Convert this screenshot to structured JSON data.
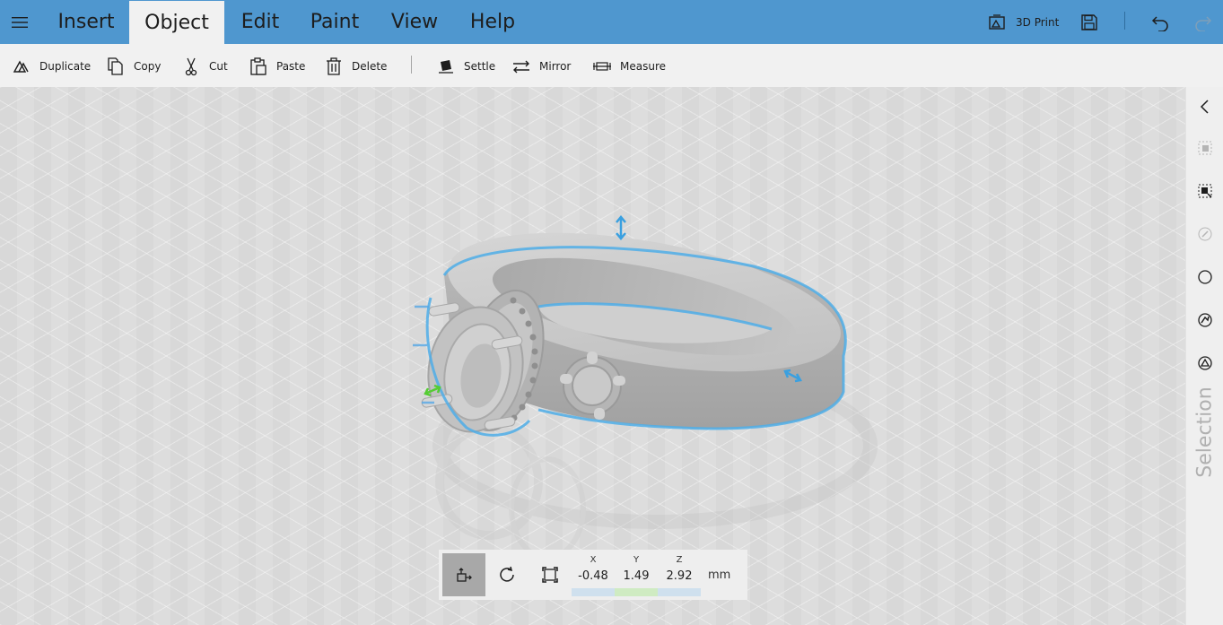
{
  "menubar": {
    "tabs": [
      {
        "label": "Insert"
      },
      {
        "label": "Object"
      },
      {
        "label": "Edit"
      },
      {
        "label": "Paint"
      },
      {
        "label": "View"
      },
      {
        "label": "Help"
      }
    ],
    "active_tab": "Object",
    "print_label": "3D Print",
    "bar_color": "#4f97cf"
  },
  "toolbar": {
    "duplicate": "Duplicate",
    "copy": "Copy",
    "cut": "Cut",
    "paste": "Paste",
    "delete": "Delete",
    "settle": "Settle",
    "mirror": "Mirror",
    "measure": "Measure"
  },
  "sidepanel": {
    "label": "Selection"
  },
  "transform": {
    "x_label": "X",
    "y_label": "Y",
    "z_label": "Z",
    "x": "-0.48",
    "y": "1.49",
    "z": "2.92",
    "unit": "mm",
    "colors": {
      "x": "#cfe0ee",
      "y": "#cfebc2",
      "z": "#cfe0ee",
      "selection": "#4faee8"
    }
  }
}
